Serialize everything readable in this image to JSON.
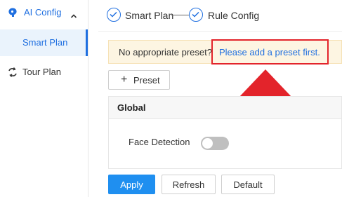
{
  "sidebar": {
    "group": {
      "label": "AI Config",
      "icon": "ai-config-icon",
      "expanded": true
    },
    "sub_items": [
      {
        "label": "Smart Plan",
        "active": true
      }
    ],
    "items": [
      {
        "label": "Tour Plan",
        "icon": "tour-plan-icon"
      }
    ]
  },
  "steps": [
    {
      "label": "Smart Plan",
      "status": "done"
    },
    {
      "label": "Rule Config",
      "status": "done"
    }
  ],
  "notice": {
    "text": "No appropriate preset?",
    "link": "Please add a preset first."
  },
  "toolbar": {
    "preset_label": "Preset",
    "preset_icon": "plus-icon"
  },
  "panel": {
    "title": "Global",
    "fields": [
      {
        "label": "Face Detection",
        "enabled": false
      }
    ]
  },
  "actions": {
    "apply": "Apply",
    "refresh": "Refresh",
    "default": "Default"
  },
  "colors": {
    "accent": "#1f6fe0",
    "primary_button": "#1f8ff0",
    "notice_bg": "#fdf5e2",
    "annotation": "#e3242b"
  }
}
